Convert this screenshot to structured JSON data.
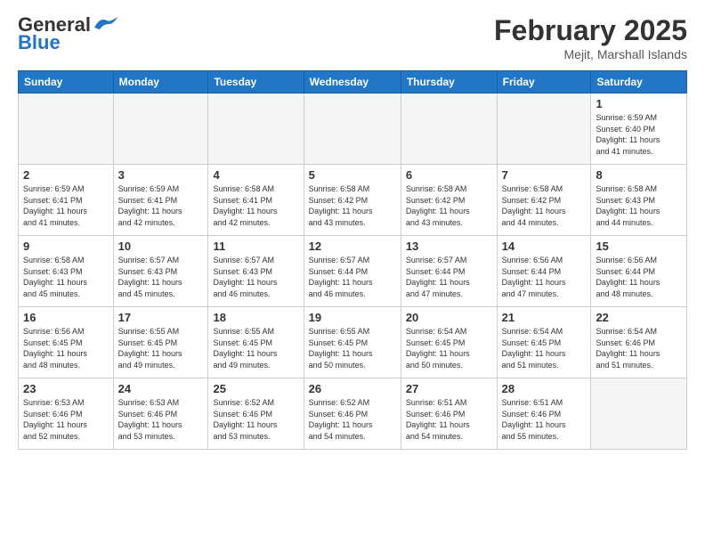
{
  "header": {
    "logo_general": "General",
    "logo_blue": "Blue",
    "month_title": "February 2025",
    "location": "Mejit, Marshall Islands"
  },
  "days_of_week": [
    "Sunday",
    "Monday",
    "Tuesday",
    "Wednesday",
    "Thursday",
    "Friday",
    "Saturday"
  ],
  "weeks": [
    [
      {
        "day": "",
        "info": ""
      },
      {
        "day": "",
        "info": ""
      },
      {
        "day": "",
        "info": ""
      },
      {
        "day": "",
        "info": ""
      },
      {
        "day": "",
        "info": ""
      },
      {
        "day": "",
        "info": ""
      },
      {
        "day": "1",
        "info": "Sunrise: 6:59 AM\nSunset: 6:40 PM\nDaylight: 11 hours\nand 41 minutes."
      }
    ],
    [
      {
        "day": "2",
        "info": "Sunrise: 6:59 AM\nSunset: 6:41 PM\nDaylight: 11 hours\nand 41 minutes."
      },
      {
        "day": "3",
        "info": "Sunrise: 6:59 AM\nSunset: 6:41 PM\nDaylight: 11 hours\nand 42 minutes."
      },
      {
        "day": "4",
        "info": "Sunrise: 6:58 AM\nSunset: 6:41 PM\nDaylight: 11 hours\nand 42 minutes."
      },
      {
        "day": "5",
        "info": "Sunrise: 6:58 AM\nSunset: 6:42 PM\nDaylight: 11 hours\nand 43 minutes."
      },
      {
        "day": "6",
        "info": "Sunrise: 6:58 AM\nSunset: 6:42 PM\nDaylight: 11 hours\nand 43 minutes."
      },
      {
        "day": "7",
        "info": "Sunrise: 6:58 AM\nSunset: 6:42 PM\nDaylight: 11 hours\nand 44 minutes."
      },
      {
        "day": "8",
        "info": "Sunrise: 6:58 AM\nSunset: 6:43 PM\nDaylight: 11 hours\nand 44 minutes."
      }
    ],
    [
      {
        "day": "9",
        "info": "Sunrise: 6:58 AM\nSunset: 6:43 PM\nDaylight: 11 hours\nand 45 minutes."
      },
      {
        "day": "10",
        "info": "Sunrise: 6:57 AM\nSunset: 6:43 PM\nDaylight: 11 hours\nand 45 minutes."
      },
      {
        "day": "11",
        "info": "Sunrise: 6:57 AM\nSunset: 6:43 PM\nDaylight: 11 hours\nand 46 minutes."
      },
      {
        "day": "12",
        "info": "Sunrise: 6:57 AM\nSunset: 6:44 PM\nDaylight: 11 hours\nand 46 minutes."
      },
      {
        "day": "13",
        "info": "Sunrise: 6:57 AM\nSunset: 6:44 PM\nDaylight: 11 hours\nand 47 minutes."
      },
      {
        "day": "14",
        "info": "Sunrise: 6:56 AM\nSunset: 6:44 PM\nDaylight: 11 hours\nand 47 minutes."
      },
      {
        "day": "15",
        "info": "Sunrise: 6:56 AM\nSunset: 6:44 PM\nDaylight: 11 hours\nand 48 minutes."
      }
    ],
    [
      {
        "day": "16",
        "info": "Sunrise: 6:56 AM\nSunset: 6:45 PM\nDaylight: 11 hours\nand 48 minutes."
      },
      {
        "day": "17",
        "info": "Sunrise: 6:55 AM\nSunset: 6:45 PM\nDaylight: 11 hours\nand 49 minutes."
      },
      {
        "day": "18",
        "info": "Sunrise: 6:55 AM\nSunset: 6:45 PM\nDaylight: 11 hours\nand 49 minutes."
      },
      {
        "day": "19",
        "info": "Sunrise: 6:55 AM\nSunset: 6:45 PM\nDaylight: 11 hours\nand 50 minutes."
      },
      {
        "day": "20",
        "info": "Sunrise: 6:54 AM\nSunset: 6:45 PM\nDaylight: 11 hours\nand 50 minutes."
      },
      {
        "day": "21",
        "info": "Sunrise: 6:54 AM\nSunset: 6:45 PM\nDaylight: 11 hours\nand 51 minutes."
      },
      {
        "day": "22",
        "info": "Sunrise: 6:54 AM\nSunset: 6:46 PM\nDaylight: 11 hours\nand 51 minutes."
      }
    ],
    [
      {
        "day": "23",
        "info": "Sunrise: 6:53 AM\nSunset: 6:46 PM\nDaylight: 11 hours\nand 52 minutes."
      },
      {
        "day": "24",
        "info": "Sunrise: 6:53 AM\nSunset: 6:46 PM\nDaylight: 11 hours\nand 53 minutes."
      },
      {
        "day": "25",
        "info": "Sunrise: 6:52 AM\nSunset: 6:46 PM\nDaylight: 11 hours\nand 53 minutes."
      },
      {
        "day": "26",
        "info": "Sunrise: 6:52 AM\nSunset: 6:46 PM\nDaylight: 11 hours\nand 54 minutes."
      },
      {
        "day": "27",
        "info": "Sunrise: 6:51 AM\nSunset: 6:46 PM\nDaylight: 11 hours\nand 54 minutes."
      },
      {
        "day": "28",
        "info": "Sunrise: 6:51 AM\nSunset: 6:46 PM\nDaylight: 11 hours\nand 55 minutes."
      },
      {
        "day": "",
        "info": ""
      }
    ]
  ]
}
